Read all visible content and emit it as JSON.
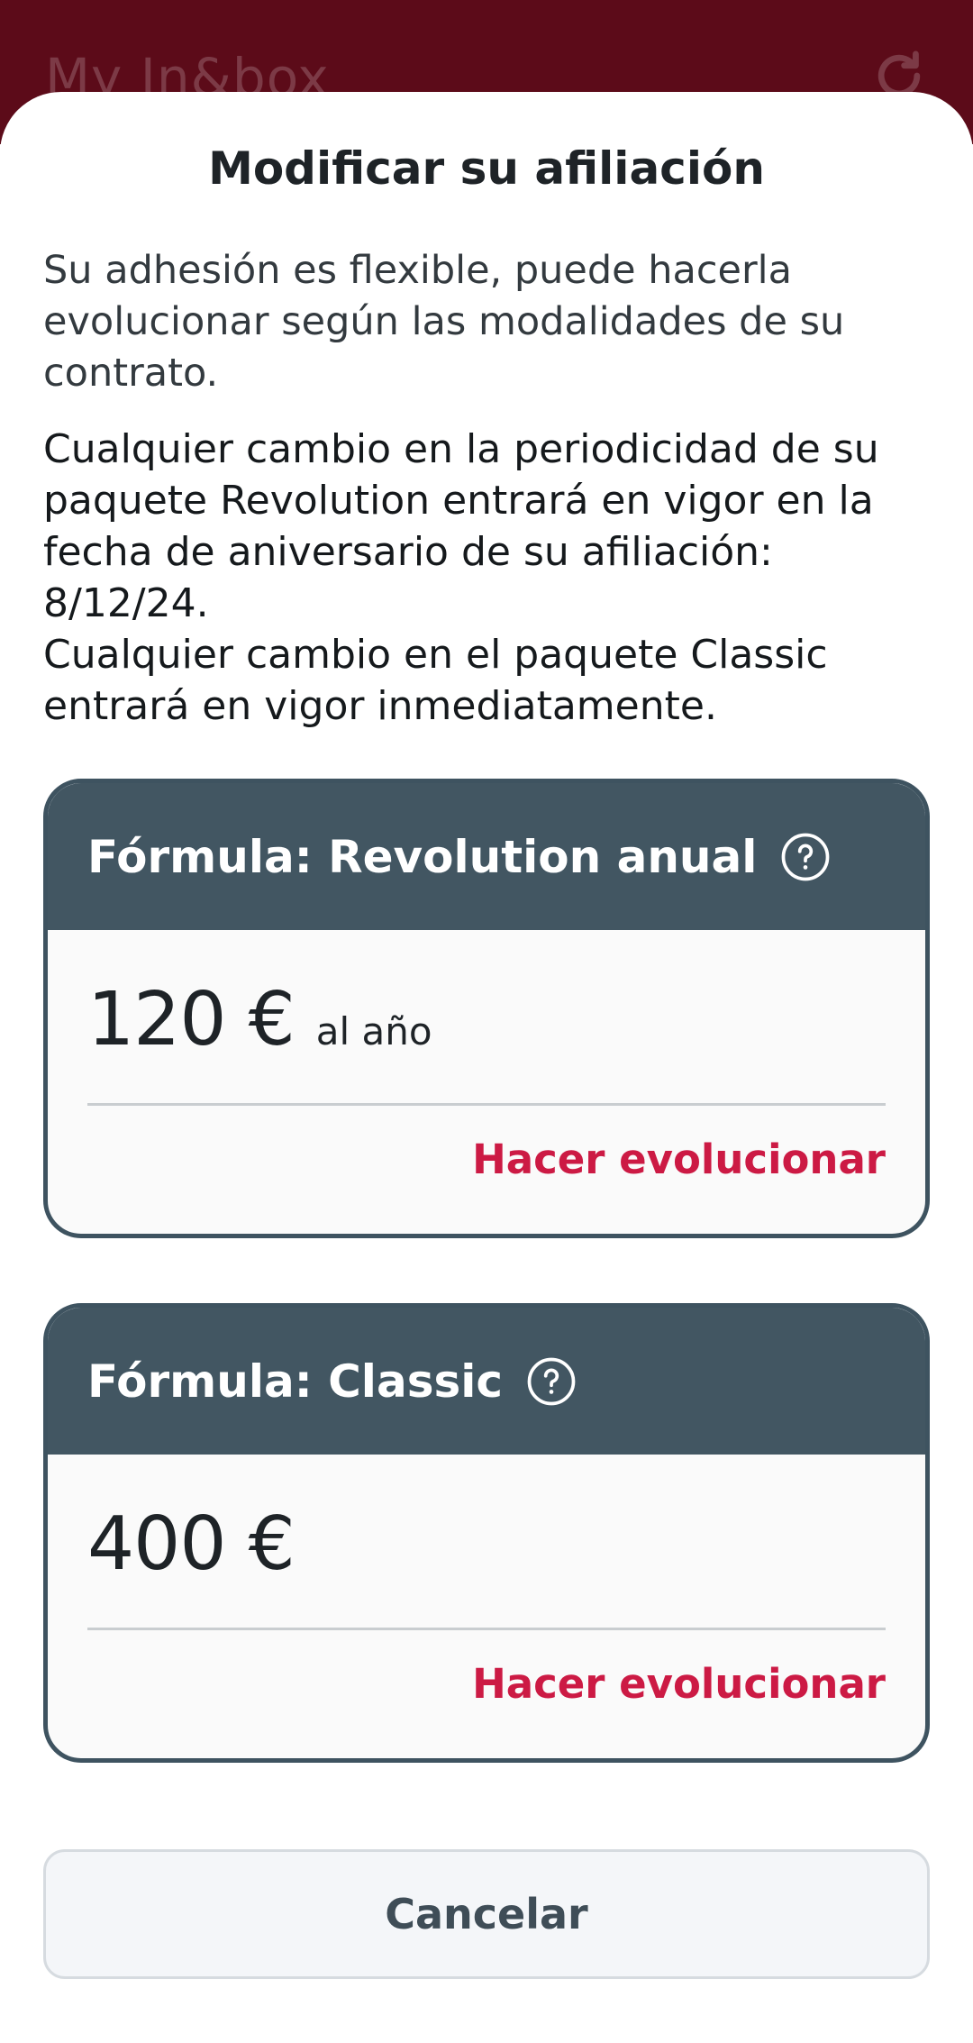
{
  "header": {
    "app_title": "My In&box",
    "refresh_icon": "refresh-icon",
    "background_color": "#5c0b19"
  },
  "sheet": {
    "title": "Modificar su afiliación",
    "intro": "Su adhesión es flexible, puede hacerla evolucionar según las modalidades de su contrato.",
    "notice_lines": [
      "Cualquier cambio en la periodicidad de su paquete Revolution entrará en vigor en la fecha de aniversario de su afiliación: 8/12/24.",
      "Cualquier cambio en el paquete Classic entrará en vigor inmediatamente."
    ]
  },
  "plans": [
    {
      "title": "Fórmula: Revolution anual",
      "price": "120 €",
      "period": "al año",
      "action_label": "Hacer evolucionar",
      "help_icon": "help-circle-icon"
    },
    {
      "title": "Fórmula: Classic",
      "price": "400 €",
      "period": "",
      "action_label": "Hacer evolucionar",
      "help_icon": "help-circle-icon"
    }
  ],
  "cancel_label": "Cancelar",
  "colors": {
    "card_header": "#425662",
    "card_border": "#3e5360",
    "action_link": "#cc1a44",
    "cancel_text": "#3f4d57"
  }
}
